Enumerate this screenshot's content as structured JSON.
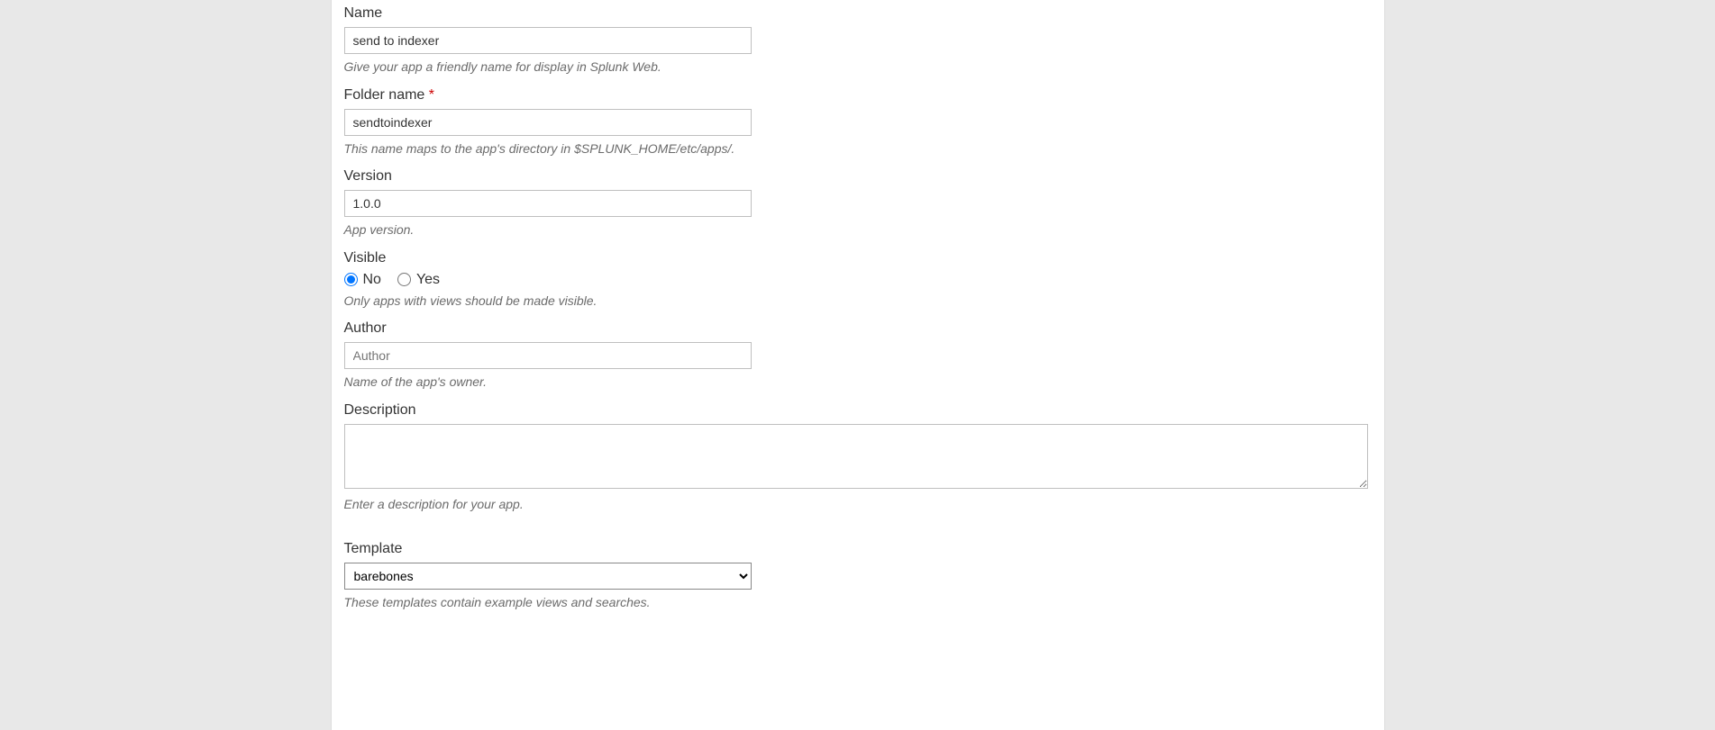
{
  "fields": {
    "name": {
      "label": "Name",
      "value": "send to indexer",
      "hint": "Give your app a friendly name for display in Splunk Web."
    },
    "folder_name": {
      "label": "Folder name",
      "required_marker": "*",
      "value": "sendtoindexer",
      "hint": "This name maps to the app's directory in $SPLUNK_HOME/etc/apps/."
    },
    "version": {
      "label": "Version",
      "value": "1.0.0",
      "hint": "App version."
    },
    "visible": {
      "label": "Visible",
      "option_no": "No",
      "option_yes": "Yes",
      "selected": "No",
      "hint": "Only apps with views should be made visible."
    },
    "author": {
      "label": "Author",
      "placeholder": "Author",
      "value": "",
      "hint": "Name of the app's owner."
    },
    "description": {
      "label": "Description",
      "value": "",
      "hint": "Enter a description for your app."
    },
    "template": {
      "label": "Template",
      "selected": "barebones",
      "hint": "These templates contain example views and searches."
    }
  }
}
